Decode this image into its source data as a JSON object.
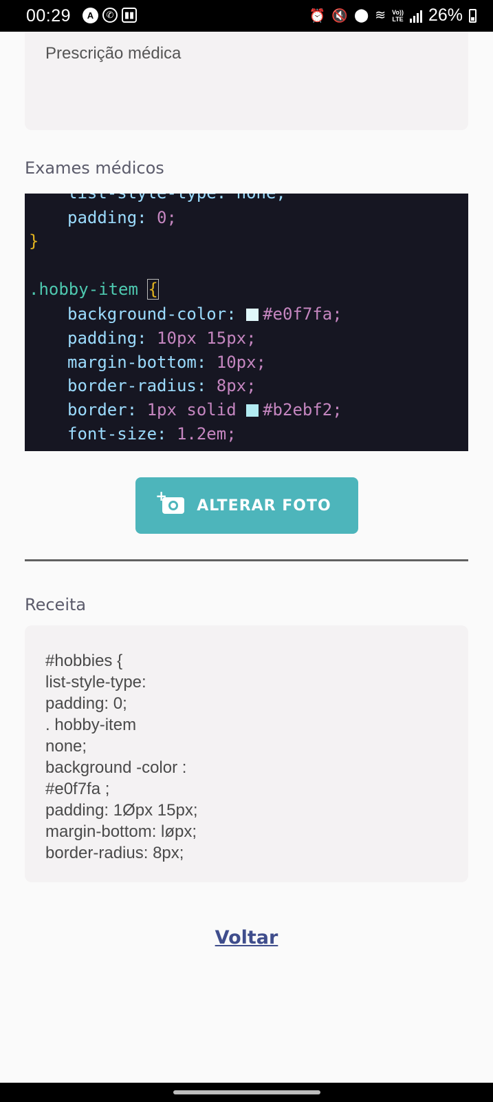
{
  "status_bar": {
    "time": "00:29",
    "battery": "26%",
    "volte": "Vo))\nLTE",
    "icons": [
      "a-icon",
      "whatsapp-icon",
      "twitch-icon",
      "alarm-icon",
      "mute-icon",
      "location-icon",
      "wifi-icon",
      "signal-icon",
      "battery-icon"
    ]
  },
  "prescricao": {
    "text": "Prescrição médica"
  },
  "exames": {
    "label": "Exames médicos",
    "code_lines": {
      "l1": "list-style-type: none;",
      "l2_prop": "padding:",
      "l2_val": "0;",
      "l3": "}",
      "l4_sel": ".hobby-item",
      "l4_brace": "{",
      "l5_prop": "background-color:",
      "l5_val": "#e0f7fa;",
      "l6_prop": "padding:",
      "l6_val": "10px 15px;",
      "l7_prop": "margin-bottom:",
      "l7_val": "10px;",
      "l8_prop": "border-radius:",
      "l8_val": "8px;",
      "l9_prop": "border:",
      "l9_val1": "1px solid",
      "l9_val2": "#b2ebf2;",
      "l10_prop": "font-size:",
      "l10_val": "1.2em;"
    },
    "swatch1": "#e0f7fa",
    "swatch2": "#b2ebf2"
  },
  "button": {
    "label": "ALTERAR FOTO",
    "color": "#4db5bb"
  },
  "receita": {
    "label": "Receita",
    "lines": [
      "#hobbies {",
      "list-style-type:",
      "padding: 0;",
      ". hobby-item",
      "none;",
      "background -color :",
      "#e0f7fa ;",
      "padding: 1Øpx 15px;",
      "margin-bottom: løpx;",
      "border-radius: 8px;"
    ]
  },
  "voltar": {
    "label": "Voltar"
  }
}
